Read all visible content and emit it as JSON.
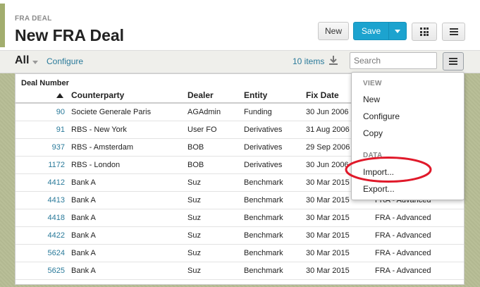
{
  "header": {
    "app_label": "FRA DEAL",
    "title": "New FRA Deal",
    "new_label": "New",
    "save_label": "Save"
  },
  "toolbar": {
    "view_label": "All",
    "configure_label": "Configure",
    "item_count": "10 items",
    "search_placeholder": "Search"
  },
  "table": {
    "columns": {
      "deal_number": "Deal Number",
      "counterparty": "Counterparty",
      "dealer": "Dealer",
      "entity": "Entity",
      "fix_date": "Fix Date",
      "type": ""
    },
    "rows": [
      {
        "num": "90",
        "counterparty": "Societe Generale Paris",
        "dealer": "AGAdmin",
        "entity": "Funding",
        "fix_date": "30 Jun 2006",
        "type": ""
      },
      {
        "num": "91",
        "counterparty": "RBS - New York",
        "dealer": "User FO",
        "entity": "Derivatives",
        "fix_date": "31 Aug 2006",
        "type": ""
      },
      {
        "num": "937",
        "counterparty": "RBS - Amsterdam",
        "dealer": "BOB",
        "entity": "Derivatives",
        "fix_date": "29 Sep 2006",
        "type": ""
      },
      {
        "num": "1172",
        "counterparty": "RBS - London",
        "dealer": "BOB",
        "entity": "Derivatives",
        "fix_date": "30 Jun 2006",
        "type": ""
      },
      {
        "num": "4412",
        "counterparty": "Bank A",
        "dealer": "Suz",
        "entity": "Benchmark",
        "fix_date": "30 Mar 2015",
        "type": ""
      },
      {
        "num": "4413",
        "counterparty": "Bank A",
        "dealer": "Suz",
        "entity": "Benchmark",
        "fix_date": "30 Mar 2015",
        "type": "FRA - Advanced"
      },
      {
        "num": "4418",
        "counterparty": "Bank A",
        "dealer": "Suz",
        "entity": "Benchmark",
        "fix_date": "30 Mar 2015",
        "type": "FRA - Advanced"
      },
      {
        "num": "4422",
        "counterparty": "Bank A",
        "dealer": "Suz",
        "entity": "Benchmark",
        "fix_date": "30 Mar 2015",
        "type": "FRA - Advanced"
      },
      {
        "num": "5624",
        "counterparty": "Bank A",
        "dealer": "Suz",
        "entity": "Benchmark",
        "fix_date": "30 Mar 2015",
        "type": "FRA - Advanced"
      },
      {
        "num": "5625",
        "counterparty": "Bank A",
        "dealer": "Suz",
        "entity": "Benchmark",
        "fix_date": "30 Mar 2015",
        "type": "FRA - Advanced"
      }
    ]
  },
  "menu": {
    "view_section": "VIEW",
    "new": "New",
    "configure": "Configure",
    "copy": "Copy",
    "data_section": "DATA",
    "import": "Import...",
    "export": "Export..."
  },
  "colors": {
    "accent": "#a2ad6e",
    "primary": "#1ca3cf",
    "link": "#2a7a9a",
    "annotation": "#e0192a"
  },
  "icons": [
    "grid-icon",
    "hamburger-icon",
    "download-icon",
    "sort-ascending-icon",
    "chevron-down-icon"
  ]
}
